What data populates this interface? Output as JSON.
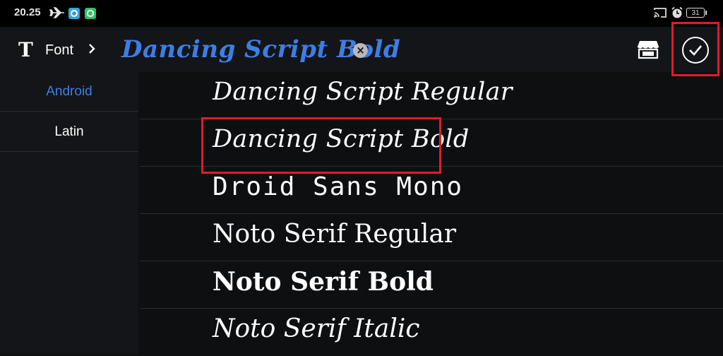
{
  "status_bar": {
    "time": "20.25",
    "battery": "31",
    "icons": [
      "airplane-mode-icon",
      "app-notification-icon",
      "chat-app-icon",
      "cast-icon",
      "alarm-icon",
      "battery-icon"
    ]
  },
  "toolbar": {
    "font_label": "Font",
    "current_font": "Dancing Script Bold",
    "icons": [
      "text-t-icon",
      "chevron-right-icon",
      "clear-icon",
      "store-icon",
      "confirm-check-icon"
    ]
  },
  "sidebar": {
    "items": [
      {
        "label": "Android",
        "selected": true
      },
      {
        "label": "Latin",
        "selected": false
      }
    ]
  },
  "font_list": {
    "items": [
      {
        "label": "Dancing Script Regular",
        "selected": false
      },
      {
        "label": "Dancing Script Bold",
        "selected": true
      },
      {
        "label": "Droid Sans Mono",
        "selected": false
      },
      {
        "label": "Noto Serif Regular",
        "selected": false
      },
      {
        "label": "Noto Serif Bold",
        "selected": false
      },
      {
        "label": "Noto Serif Italic",
        "selected": false
      }
    ]
  },
  "colors": {
    "accent": "#3d7ee6",
    "highlight_box": "#e01b2a",
    "background": "#0e0f11",
    "panel": "#141518",
    "divider": "#2c2d31"
  }
}
